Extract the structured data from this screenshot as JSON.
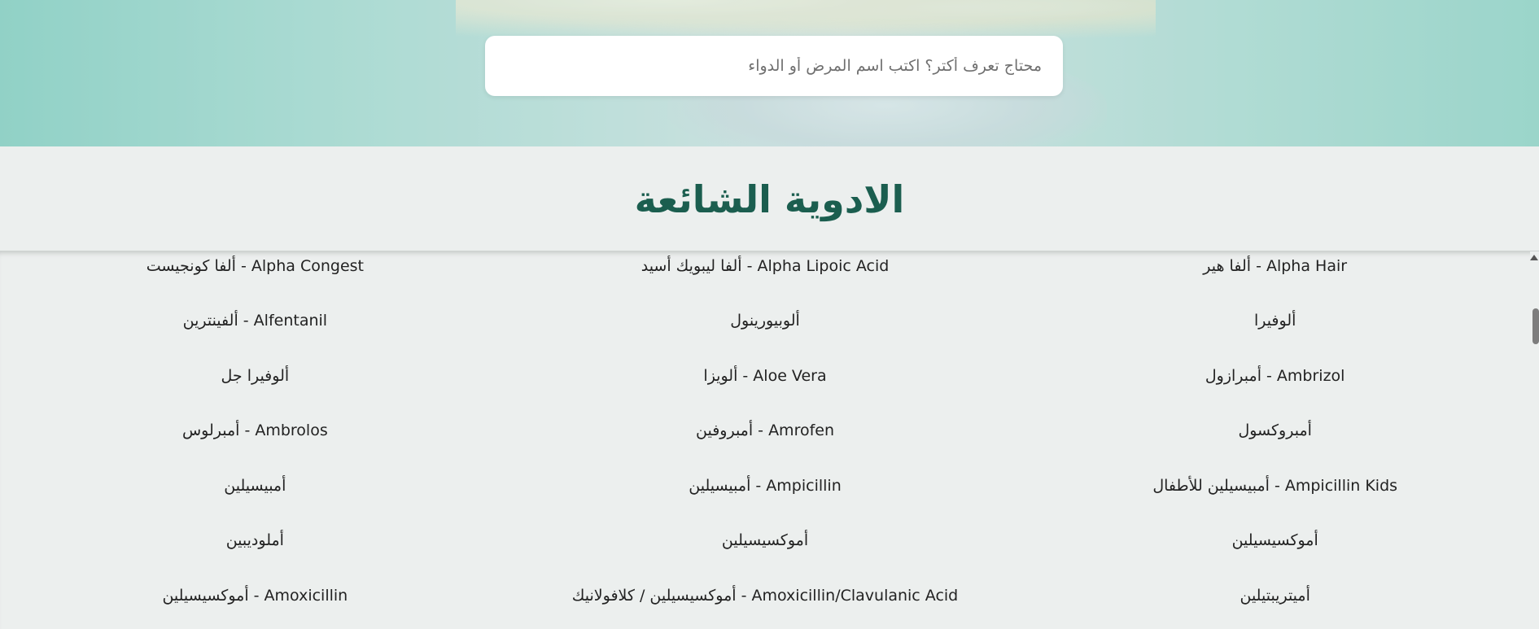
{
  "search": {
    "placeholder": "محتاج تعرف أكتر؟ اكتب اسم المرض أو الدواء"
  },
  "section": {
    "title": "الادوية الشائعة"
  },
  "drugs": [
    "Alpha Hair - ألفا هير",
    "Alpha Lipoic Acid - ألفا ليبويك أسيد",
    "Alpha Congest - ألفا كونجيست",
    "ألوفيرا",
    "ألوبيورينول",
    "Alfentanil - ألفينترين",
    "Ambrizol - أمبرازول",
    "Aloe Vera - ألويزا",
    "ألوفيرا جل",
    "أمبروكسول",
    "Amrofen - أمبروفين",
    "Ambrolos - أمبرلوس",
    "Ampicillin Kids - أمبيسيلين للأطفال",
    "Ampicillin - أمبيسيلين",
    "أمبيسيلين",
    "أموكسيسيلين",
    "أموكسيسيلين",
    "أملوديبين",
    "أميتريبتيلين",
    "Amoxicillin/Clavulanic Acid - أموكسيسيلين / كلافولانيك",
    "Amoxicillin - أموكسيسيلين"
  ]
}
